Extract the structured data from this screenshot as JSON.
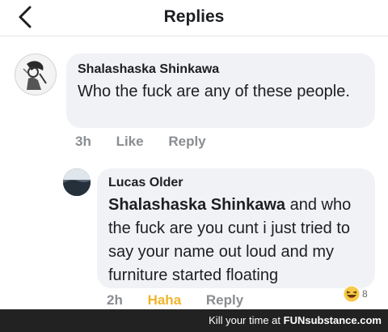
{
  "header": {
    "title": "Replies"
  },
  "comments": [
    {
      "author": "Shalashaska Shinkawa",
      "text": "Who the fuck are any of these people.",
      "meta": {
        "time": "3h",
        "like": "Like",
        "reply": "Reply"
      }
    },
    {
      "author": "Lucas Older",
      "mention": "Shalashaska Shinkawa",
      "text": " and who the fuck are you cunt i just tried to say your name out loud and my furniture started floating",
      "meta": {
        "time": "2h",
        "reaction": "Haha",
        "reply": "Reply"
      },
      "reaction_count": "8"
    }
  ],
  "footer": {
    "text": "Kill your time at ",
    "brand": "FUNsubstance.com"
  },
  "colors": {
    "bubble": "#f0f2f5",
    "haha": "#f0b429",
    "meta": "#8a8d91"
  }
}
